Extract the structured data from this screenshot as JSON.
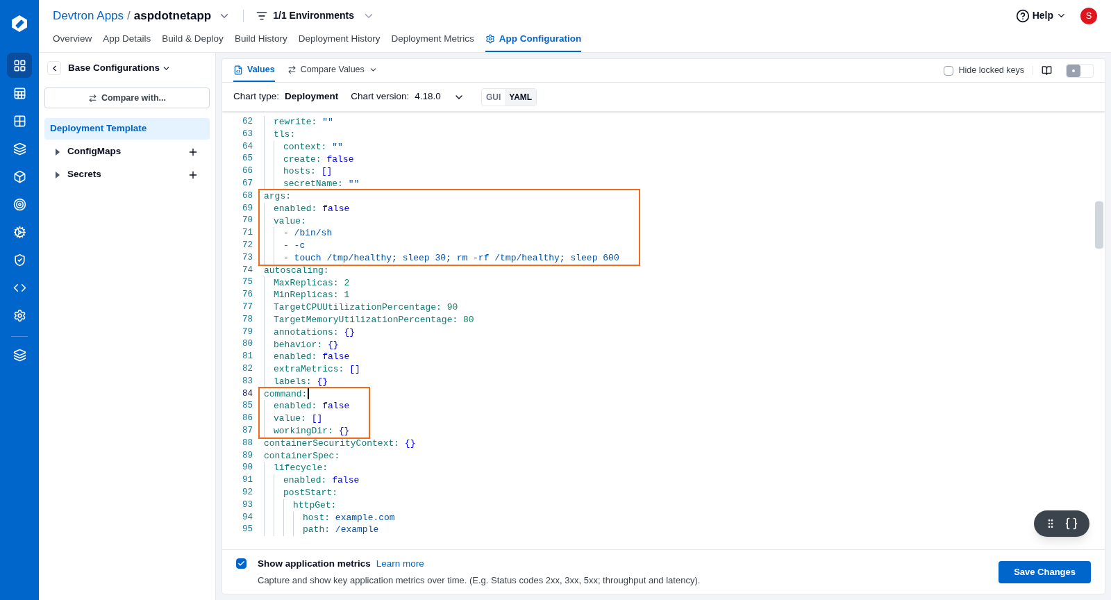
{
  "header": {
    "breadcrumb_parent": "Devtron Apps",
    "breadcrumb_separator": "/",
    "app_name": "aspdotnetapp",
    "environments": "1/1 Environments",
    "help": "Help",
    "avatar": "S"
  },
  "tabs": [
    {
      "label": "Overview",
      "selected": false
    },
    {
      "label": "App Details",
      "selected": false
    },
    {
      "label": "Build & Deploy",
      "selected": false
    },
    {
      "label": "Build History",
      "selected": false
    },
    {
      "label": "Deployment History",
      "selected": false
    },
    {
      "label": "Deployment Metrics",
      "selected": false
    },
    {
      "label": "App Configuration",
      "selected": true
    }
  ],
  "config_panel": {
    "title": "Base Configurations",
    "compare_button": "Compare with...",
    "items": [
      {
        "label": "Deployment Template",
        "kind": "leaf",
        "selected": true
      },
      {
        "label": "ConfigMaps",
        "kind": "group",
        "selected": false
      },
      {
        "label": "Secrets",
        "kind": "group",
        "selected": false
      }
    ]
  },
  "editor": {
    "tabs": [
      {
        "label": "Values",
        "selected": true
      },
      {
        "label": "Compare Values",
        "selected": false
      }
    ],
    "hide_locked_keys": {
      "label": "Hide locked keys",
      "checked": false
    },
    "view_switch": {
      "on": false
    },
    "chart_type_label": "Chart type:",
    "chart_type": "Deployment",
    "chart_version_label": "Chart version:",
    "chart_version": "4.18.0",
    "modes": [
      {
        "label": "GUI",
        "selected": false
      },
      {
        "label": "YAML",
        "selected": true
      }
    ],
    "blocks": [
      {
        "highlighted": false,
        "lines": [
          {
            "children": [
              {
                "number": "62",
                "key": "rewrite:",
                "value": "\"\"",
                "kind": "string"
              },
              {
                "number": "63",
                "key": "tls:",
                "children": [
                  {
                    "number": "64",
                    "key": "context:",
                    "value": "\"\"",
                    "kind": "string"
                  },
                  {
                    "number": "65",
                    "key": "create:",
                    "value": "false",
                    "kind": "bool"
                  },
                  {
                    "number": "66",
                    "key": "hosts:",
                    "value": "[]",
                    "kind": "collection"
                  },
                  {
                    "number": "67",
                    "key": "secretName:",
                    "value": "\"\"",
                    "kind": "string"
                  }
                ]
              }
            ]
          }
        ]
      },
      {
        "highlighted": true,
        "lines": [
          {
            "number": "68",
            "key": "args:",
            "children": [
              {
                "number": "69",
                "key": "enabled:",
                "value": "false",
                "kind": "bool"
              },
              {
                "number": "70",
                "key": "value:",
                "children": [
                  {
                    "number": "71",
                    "value": "- /bin/sh",
                    "kind": "item"
                  },
                  {
                    "number": "72",
                    "value": "- -c",
                    "kind": "item"
                  },
                  {
                    "number": "73",
                    "value": "- touch /tmp/healthy; sleep 30; rm -rf /tmp/healthy; sleep 600",
                    "kind": "item"
                  }
                ]
              }
            ]
          }
        ]
      },
      {
        "highlighted": false,
        "lines": [
          {
            "number": "74",
            "key": "autoscaling:",
            "children": [
              {
                "number": "75",
                "key": "MaxReplicas:",
                "value": "2",
                "kind": "number"
              },
              {
                "number": "76",
                "key": "MinReplicas:",
                "value": "1",
                "kind": "number"
              },
              {
                "number": "77",
                "key": "TargetCPUUtilizationPercentage:",
                "value": "90",
                "kind": "number"
              },
              {
                "number": "78",
                "key": "TargetMemoryUtilizationPercentage:",
                "value": "80",
                "kind": "number"
              },
              {
                "number": "79",
                "key": "annotations:",
                "value": "{}",
                "kind": "collection"
              },
              {
                "number": "80",
                "key": "behavior:",
                "value": "{}",
                "kind": "collection"
              },
              {
                "number": "81",
                "key": "enabled:",
                "value": "false",
                "kind": "bool"
              },
              {
                "number": "82",
                "key": "extraMetrics:",
                "value": "[]",
                "kind": "collection"
              },
              {
                "number": "83",
                "key": "labels:",
                "value": "{}",
                "kind": "collection"
              }
            ]
          }
        ]
      },
      {
        "highlighted": true,
        "lines": [
          {
            "number": "84",
            "key": "command:",
            "cursor": true,
            "children": [
              {
                "number": "85",
                "key": "enabled:",
                "value": "false",
                "kind": "bool"
              },
              {
                "number": "86",
                "key": "value:",
                "value": "[]",
                "kind": "collection"
              },
              {
                "number": "87",
                "key": "workingDir:",
                "value": "{}",
                "kind": "collection"
              }
            ]
          }
        ]
      },
      {
        "highlighted": false,
        "lines": [
          {
            "number": "88",
            "key": "containerSecurityContext:",
            "value": "{}",
            "kind": "collection"
          },
          {
            "number": "89",
            "key": "containerSpec:",
            "children": [
              {
                "number": "90",
                "key": "lifecycle:",
                "children": [
                  {
                    "number": "91",
                    "key": "enabled:",
                    "value": "false",
                    "kind": "bool"
                  },
                  {
                    "number": "92",
                    "key": "postStart:",
                    "children": [
                      {
                        "number": "93",
                        "key": "httpGet:",
                        "children": [
                          {
                            "number": "94",
                            "key": "host:",
                            "value": "example.com",
                            "kind": "string"
                          },
                          {
                            "number": "95",
                            "key": "path:",
                            "value": "/example",
                            "kind": "string"
                          }
                        ]
                      }
                    ]
                  }
                ]
              }
            ]
          }
        ]
      }
    ]
  },
  "footer": {
    "metrics": {
      "label": "Show application metrics",
      "checked": true,
      "link": "Learn more",
      "description": "Capture and show key application metrics over time. (E.g. Status codes 2xx, 3xx, 5xx; throughput and latency)."
    },
    "save_button": "Save Changes"
  }
}
